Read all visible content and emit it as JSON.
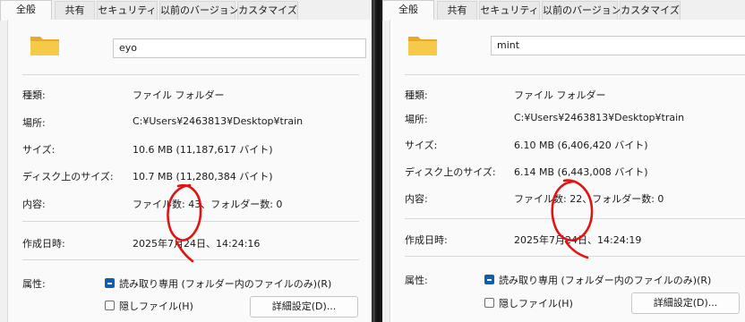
{
  "tabs": [
    "全般",
    "共有",
    "セキュリティ",
    "以前のバージョン",
    "カスタマイズ"
  ],
  "labels": {
    "type": "種類:",
    "location": "場所:",
    "size": "サイズ:",
    "size_on_disk": "ディスク上のサイズ:",
    "contains": "内容:",
    "created": "作成日時:",
    "attributes": "属性:"
  },
  "attributes": {
    "readonly_label": "読み取り専用 (フォルダー内のファイルのみ)(R)",
    "readonly_state": "indeterminate",
    "hidden_label": "隠しファイル(H)",
    "hidden_checked": false,
    "advanced_button": "詳細設定(D)..."
  },
  "annotation_color": "#e01414",
  "windows": [
    {
      "name": "eyo",
      "type": "ファイル フォルダー",
      "location": "C:¥Users¥2463813¥Desktop¥train",
      "size": "10.6 MB (11,187,617 バイト)",
      "size_on_disk": "10.7 MB (11,280,384 バイト)",
      "contains": "ファイル数: 43、フォルダー数: 0",
      "created": "2025年7月24日、14:24:16"
    },
    {
      "name": "mint",
      "type": "ファイル フォルダー",
      "location": "C:¥Users¥2463813¥Desktop¥train",
      "size": "6.10 MB (6,406,420 バイト)",
      "size_on_disk": "6.14 MB (6,443,008 バイト)",
      "contains": "ファイル数: 22、フォルダー数: 0",
      "created": "2025年7月24日、14:24:19"
    }
  ]
}
